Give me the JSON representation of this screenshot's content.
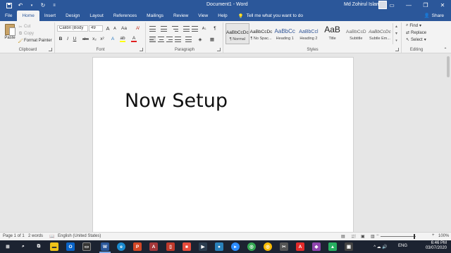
{
  "app": {
    "doc_title": "Document1 - Word",
    "user_name": "Md Zohirul Islam"
  },
  "tabs": [
    "File",
    "Home",
    "Insert",
    "Design",
    "Layout",
    "References",
    "Mailings",
    "Review",
    "View",
    "Help"
  ],
  "tell_me": "Tell me what you want to do",
  "share_label": "Share",
  "clipboard": {
    "paste": "Paste",
    "cut": "Cut",
    "copy": "Copy",
    "format_painter": "Format Painter",
    "label": "Clipboard"
  },
  "font": {
    "family": "Calibri (Body",
    "size": "49",
    "grow": "A",
    "shrink": "A",
    "change_case": "Aa",
    "bold": "B",
    "italic": "I",
    "underline": "U",
    "strike": "abc",
    "subscript": "x₂",
    "superscript": "x²",
    "text_effects": "A",
    "highlight": "ab",
    "font_color": "A",
    "label": "Font"
  },
  "paragraph": {
    "pilcrow": "¶",
    "sort": "A↓",
    "label": "Paragraph"
  },
  "styles": {
    "items": [
      {
        "sample": "AaBbCcDc",
        "name": "¶ Normal"
      },
      {
        "sample": "AaBbCcDc",
        "name": "¶ No Spac..."
      },
      {
        "sample": "AaBbCc",
        "name": "Heading 1"
      },
      {
        "sample": "AaBbCcl",
        "name": "Heading 2"
      },
      {
        "sample": "AaB",
        "name": "Title"
      },
      {
        "sample": "AaBbCcD",
        "name": "Subtitle"
      },
      {
        "sample": "AaBbCcDc",
        "name": "Subtle Em..."
      }
    ],
    "label": "Styles"
  },
  "editing": {
    "find": "Find",
    "replace": "Replace",
    "select": "Select",
    "label": "Editing"
  },
  "document": {
    "text": "Now Setup"
  },
  "status": {
    "page": "Page 1 of 1",
    "words": "2 words",
    "language": "English (United States)",
    "zoom": "100%"
  },
  "taskbar": {
    "lang": "ENG",
    "time": "6:46 PM",
    "date": "03/07/2020"
  },
  "colors": {
    "word_blue": "#2b579a",
    "ribbon_bg": "#f3f3f3",
    "canvas_bg": "#e6e6e6",
    "taskbar_bg": "#1c2331"
  }
}
